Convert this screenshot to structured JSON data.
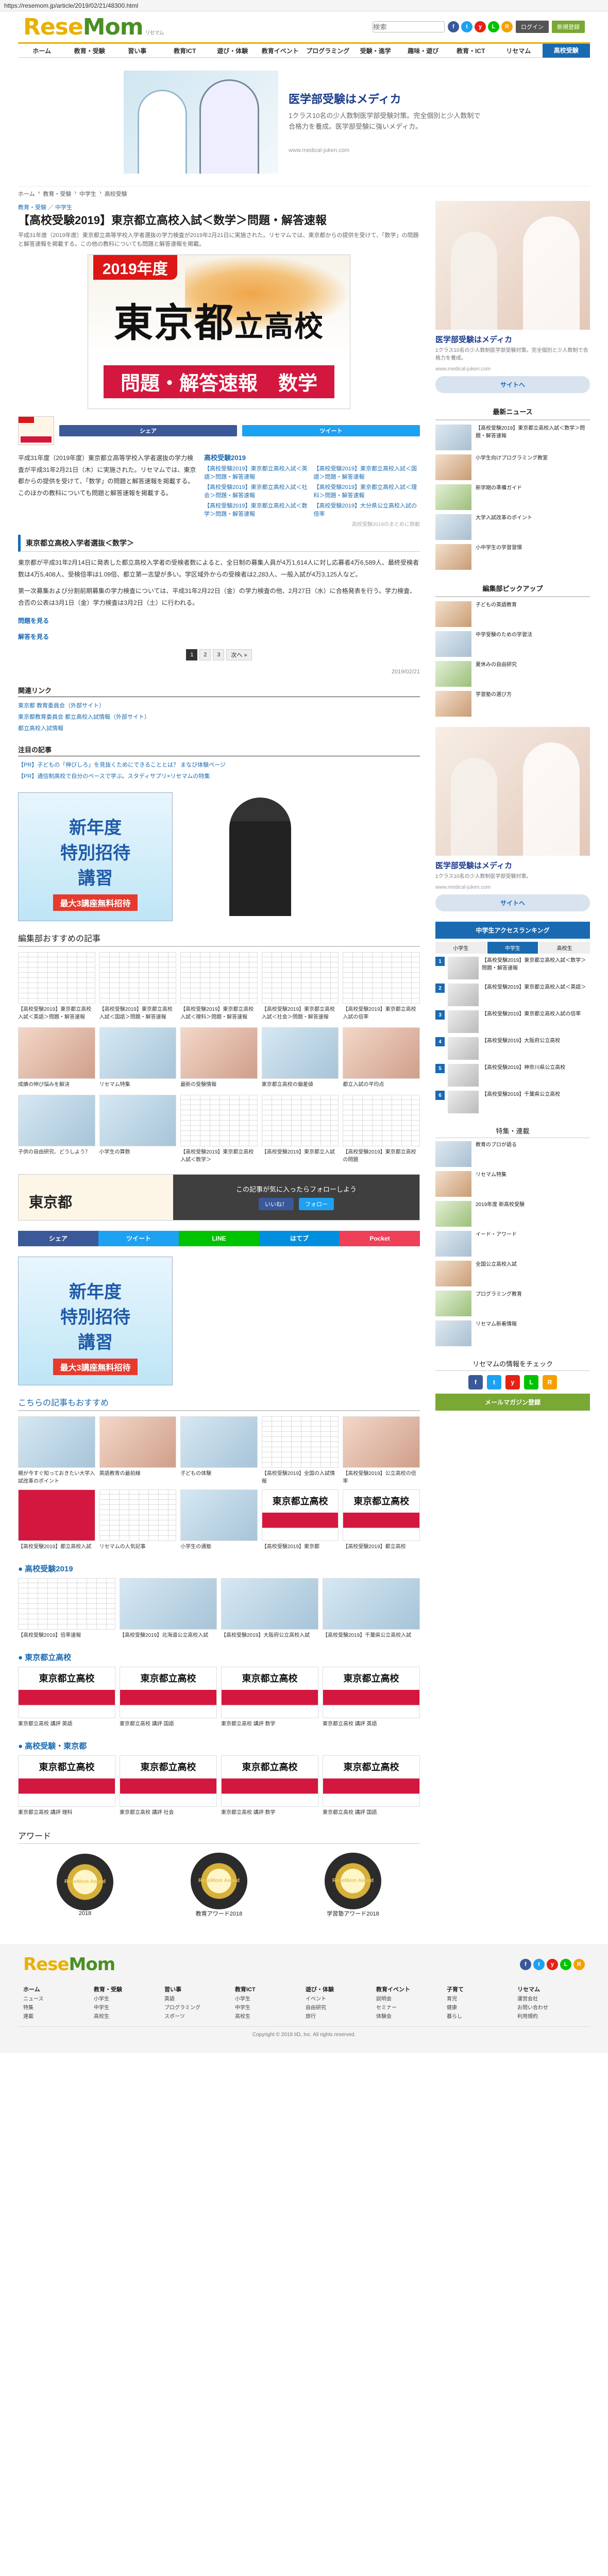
{
  "url": "https://resemom.jp/article/2019/02/21/48300.html",
  "logo": {
    "a": "Rese",
    "b": "Mom",
    "tag": "リセマム"
  },
  "search_placeholder": "検索",
  "header": {
    "login": "ログイン",
    "register": "新規登録"
  },
  "social": [
    {
      "l": "f",
      "c": "#3b5998"
    },
    {
      "l": "t",
      "c": "#1da1f2"
    },
    {
      "l": "y",
      "c": "#e62117"
    },
    {
      "l": "L",
      "c": "#00c300"
    },
    {
      "l": "R",
      "c": "#f4a100"
    }
  ],
  "nav": [
    "ホーム",
    "教育・受験",
    "習い事",
    "教育ICT",
    "遊び・体験",
    "教育イベント",
    "プログラミング",
    "受験・進学",
    "趣味・遊び",
    "教育・ICT",
    "リセマム",
    "高校受験"
  ],
  "topad": {
    "title": "医学部受験はメディカ",
    "desc": "1クラス10名の少人数制医学部受験対策。完全個別と少人数制で合格力を養成。医学部受験に強いメディカ。",
    "url": "www.medical-juken.com"
  },
  "breadcrumb": [
    "ホーム",
    "教育・受験",
    "中学生",
    "高校受験"
  ],
  "tags": "教育・受験 ／ 中学生",
  "article": {
    "title": "【高校受験2019】東京都立高校入試＜数学＞問題・解答速報",
    "lead": "平成31年度（2019年度）東京都立高等学校入学者選抜の学力検査が2019年2月21日に実施された。リセマムでは、東京都からの提供を受けて、「数学」の問題と解答速報を掲載する。この他の教科についても問題と解答速報を掲載。",
    "hero": {
      "year": "2019年度",
      "big": "東京都",
      "small": "立高校",
      "band": [
        "問題・解答速報",
        "数学"
      ]
    },
    "share": [
      {
        "l": "シェア",
        "c": "#3b5998"
      },
      {
        "l": "ツイート",
        "c": "#1da1f2"
      }
    ],
    "body1": "平成31年度（2019年度）東京都立高等学校入学者選抜の学力検査が平成31年2月21日（木）に実施された。リセマムでは、東京都からの提供を受けて、「数学」の問題と解答速報を掲載する。このほかの教科についても問題と解答速報を掲載する。",
    "related_title": "高校受験2019",
    "related": [
      [
        "【高校受験2019】東京都立高校入試＜英語＞問題・解答速報",
        "【高校受験2019】東京都立高校入試＜国語＞問題・解答速報"
      ],
      [
        "【高校受験2019】東京都立高校入試＜社会＞問題・解答速報",
        "【高校受験2019】東京都立高校入試＜理科＞問題・解答速報"
      ],
      [
        "【高校受験2019】東京都立高校入試＜数学＞問題・解答速報",
        "【高校受験2019】大分県公立高校入試の倍率"
      ]
    ],
    "related_hint": "高校受験2019のまとめに移動",
    "subhead": "東京都立高校入学者選抜＜数学＞",
    "para1": "東京都が平成31年2月14日に発表した都立高校入学者の受検者数によると、全日制の募集人員が4万1,614人に対し応募者4万6,589人、最終受検者数は4万5,408人、受検倍率は1.09倍、都立第一志望が多い。学区域外からの受検者は2,283人、一般入試が4万3,125人など。",
    "para2": "第一次募集および分割前期募集の学力検査については、平成31年2月22日（金）の学力検査の他、2月27日（水）に合格発表を行う。学力検査、合否の公表は3月1日（金）学力検査は3月2日（土）に行われる。",
    "link1": "問題を見る",
    "link2": "解答を見る",
    "pages": [
      "1",
      "2",
      "3",
      "次へ »"
    ],
    "date": "2019/02/21"
  },
  "links_label": "関連リンク",
  "links": [
    "東京都 教育委員会（外部サイト）",
    "東京都教育委員会 都立高校入試情報（外部サイト）",
    "都立高校入試情報"
  ],
  "pr_label": "注目の記事",
  "pr": [
    "【PR】子どもの「伸びしろ」を見抜くためにできることとは？ まなび体験ページ",
    "【PR】通信制高校で自分のペースで学ぶ。スタディサプリ×リセマムの特集"
  ],
  "ad_new": {
    "l1": "新年度",
    "l2": "特別招待",
    "l3": "講習",
    "sub": "最大3講座無料招待"
  },
  "recommend_title": "編集部おすすめの記事",
  "recommend": [
    "【高校受験2019】東京都立高校入試＜英語＞問題・解答速報",
    "【高校受験2019】東京都立高校入試＜国語＞問題・解答速報",
    "【高校受験2019】東京都立高校入試＜理科＞問題・解答速報",
    "【高校受験2019】東京都立高校入試＜社会＞問題・解答速報",
    "【高校受験2019】東京都立高校入試の倍率"
  ],
  "recommend2": [
    "成績の伸び悩みを解決",
    "リセマム特集",
    "最新の受験情報",
    "東京都立高校の偏差値",
    "都立入試の平均点"
  ],
  "recommend3": [
    "子供の自由研究、どうしよう？",
    "小学生の算数",
    "【高校受験2019】東京都立高校入試＜数学＞",
    "【高校受験2019】東京都立入試",
    "【高校受験2019】東京都立高校の問題"
  ],
  "follow": {
    "text": "この記事が気に入ったらフォローしよう",
    "fb": "いいね！",
    "tw": "フォロー"
  },
  "sharerow": [
    {
      "l": "シェア",
      "c": "#3b5998"
    },
    {
      "l": "ツイート",
      "c": "#1da1f2"
    },
    {
      "l": "LINE",
      "c": "#00c300"
    },
    {
      "l": "はてブ",
      "c": "#008fde"
    },
    {
      "l": "Pocket",
      "c": "#ee4056"
    }
  ],
  "also_title": "こちらの記事もおすすめ",
  "also": [
    "親が今すぐ知っておきたい大学入試改革のポイント",
    "英語教育の最前線",
    "子どもの体験",
    "【高校受験2019】全国の入試情報",
    "【高校受験2019】公立高校の倍率",
    "【高校受験2019】都立高校入試",
    "リセマムの人気記事",
    "小学生の通塾",
    "【高校受験2019】東京都",
    "【高校受験2019】都立高校"
  ],
  "cat1": "高校受験2019",
  "cat1_items": [
    "【高校受験2019】倍率速報",
    "【高校受験2019】北海道公立高校入試",
    "【高校受験2019】大阪府公立高校入試",
    "【高校受験2019】千葉県公立高校入試"
  ],
  "cat2": "東京都立高校",
  "cat2_items": [
    "東京都立高校 講評 英語",
    "東京都立高校 講評 国語",
    "東京都立高校 講評 数学",
    "東京都立高校 講評 英語"
  ],
  "cat3": "高校受験・東京都",
  "cat3_items": [
    "東京都立高校 講評 理科",
    "東京都立高校 講評 社会",
    "東京都立高校 講評 数学",
    "東京都立高校 講評 国語"
  ],
  "awards_title": "アワード",
  "awards": [
    {
      "m": "ReseMom Award",
      "l": "2018"
    },
    {
      "m": "ReseMom Award",
      "l": "教育アワード2018"
    },
    {
      "m": "ReseMom Award",
      "l": "学習塾アワード2018"
    }
  ],
  "side": {
    "ad": {
      "title": "医学部受験はメディカ",
      "desc": "1クラス10名の少人数制医学部受験対策。完全個別と少人数制で合格力を養成。",
      "url": "www.medical-juken.com",
      "btn": "サイトへ"
    },
    "news_title": "最新ニュース",
    "news": [
      "【高校受験2019】東京都立高校入試＜数学＞問題・解答速報",
      "小学生向けプログラミング教室",
      "新学期の準備ガイド",
      "大学入試改革のポイント",
      "小中学生の学習習慣"
    ],
    "pickup_title": "編集部ピックアップ",
    "pickup": [
      "子どもの英語教育",
      "中学受験のための学習法",
      "夏休みの自由研究",
      "学習塾の選び方"
    ],
    "ad2": {
      "title": "医学部受験はメディカ",
      "desc": "1クラス10名の少人数制医学部受験対策。",
      "url": "www.medical-juken.com",
      "btn": "サイトへ"
    },
    "rank_title": "中学生アクセスランキング",
    "ranks": [
      "【高校受験2019】東京都立高校入試＜数学＞問題・解答速報",
      "【高校受験2019】東京都立高校入試＜英語＞",
      "【高校受験2019】東京都立高校入試の倍率",
      "【高校受験2019】大阪府公立高校",
      "【高校受験2019】神奈川県公立高校",
      "【高校受験2019】千葉県公立高校"
    ],
    "tabs": [
      "小学生",
      "中学生",
      "高校生"
    ],
    "special_title": "特集・連載",
    "special": [
      "教育のプロが語る",
      "リセマム特集",
      "2019年度 新高校受験",
      "イード・アワード",
      "全国公立高校入試",
      "プログラミング教育",
      "リセマム新着情報"
    ],
    "cta1": "リセマムの情報をチェック",
    "cta2": "メールマガジン登録"
  },
  "footer": {
    "cols": [
      {
        "h": "ホーム",
        "i": [
          "ニュース",
          "特集",
          "連載"
        ]
      },
      {
        "h": "教育・受験",
        "i": [
          "小学生",
          "中学生",
          "高校生"
        ]
      },
      {
        "h": "習い事",
        "i": [
          "英語",
          "プログラミング",
          "スポーツ"
        ]
      },
      {
        "h": "教育ICT",
        "i": [
          "小学生",
          "中学生",
          "高校生"
        ]
      },
      {
        "h": "遊び・体験",
        "i": [
          "イベント",
          "自由研究",
          "旅行"
        ]
      },
      {
        "h": "教育イベント",
        "i": [
          "説明会",
          "セミナー",
          "体験会"
        ]
      },
      {
        "h": "子育て",
        "i": [
          "育児",
          "健康",
          "暮らし"
        ]
      },
      {
        "h": "リセマム",
        "i": [
          "運営会社",
          "お問い合わせ",
          "利用規約"
        ]
      }
    ],
    "copy": "Copyright © 2019 IID, Inc. All rights reserved."
  }
}
